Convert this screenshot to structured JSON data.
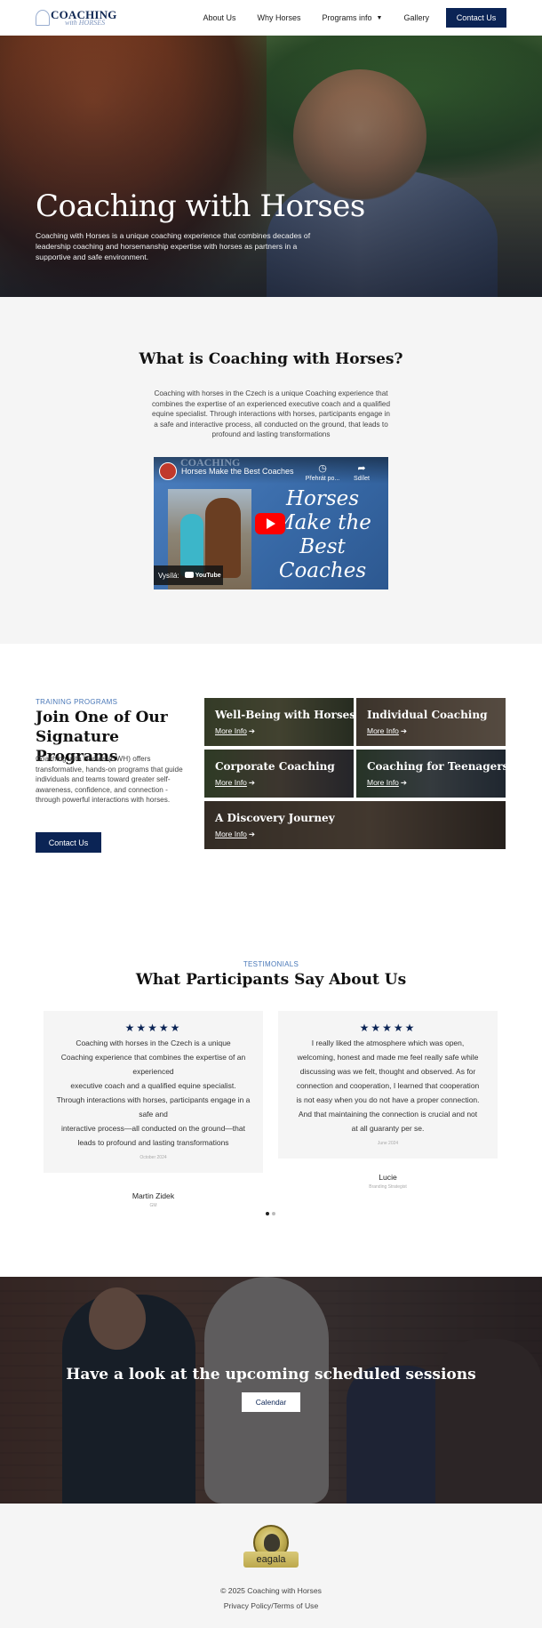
{
  "header": {
    "logo_main": "COACHING",
    "logo_sub": "with HORSES",
    "nav": [
      "About Us",
      "Why Horses",
      "Programs info",
      "Gallery"
    ],
    "contact_label": "Contact Us"
  },
  "hero": {
    "title": "Coaching with Horses",
    "description": "Coaching with Horses is a unique coaching experience that combines decades of leadership coaching and horsemanship expertise with horses as partners in a supportive and safe environment."
  },
  "what_is": {
    "title": "What is Coaching with Horses?",
    "description": "Coaching with horses in the Czech is a unique Coaching experience that combines the expertise of an experienced executive coach and a qualified equine specialist. Through interactions with horses, participants engage in a safe and interactive process, all conducted on the ground, that leads to profound and lasting transformations",
    "video": {
      "title": "Horses Make the Best Coaches",
      "watermark": "COACHING",
      "action_watch": "Přehrát po...",
      "action_share": "Sdílet",
      "overlay_text": "Horses Make the Best Coaches",
      "badge_label": "Vysílá:",
      "badge_brand": "YouTube"
    }
  },
  "programs": {
    "eyebrow": "TRAINING PROGRAMS",
    "title": "Join One of Our Signature Programs",
    "description": "Coaching with Horses (CWH) offers transformative, hands-on programs that guide individuals and teams toward greater self-awareness, confidence, and connection - through powerful interactions with horses.",
    "cta": "Contact Us",
    "link_label": "More Info",
    "cards": [
      {
        "title": "Well-Being with Horses"
      },
      {
        "title": "Individual Coaching"
      },
      {
        "title": "Corporate Coaching"
      },
      {
        "title": "Coaching for Teenagers"
      },
      {
        "title": "A Discovery Journey"
      }
    ]
  },
  "testimonials": {
    "eyebrow": "TESTIMONIALS",
    "title": "What Participants Say About Us",
    "stars": "★★★★★",
    "items": [
      {
        "lines": [
          "Coaching with horses in the Czech is a unique",
          "Coaching experience that combines the expertise of an experienced",
          "executive coach and a qualified equine specialist.",
          "Through interactions with horses, participants engage in a safe and",
          "interactive process—all conducted on the ground—that",
          "leads to profound and lasting transformations"
        ],
        "date": "October 2024",
        "name": "Martin Zidek",
        "role": "GM"
      },
      {
        "lines": [
          "I really liked the atmosphere which was open,",
          "welcoming, honest and made me feel really safe while",
          "discussing was we felt, thought and observed. As for",
          "connection and cooperation, I learned that cooperation",
          "is not easy when you do not have a proper connection.",
          "And that maintaining the connection is crucial and not",
          "at all guaranty per se."
        ],
        "date": "June 2024",
        "name": "Lucie",
        "role": "Branding Strategist"
      }
    ],
    "prev_icon": "chevron-left-icon",
    "next_icon": "chevron-right-icon"
  },
  "sessions": {
    "title": "Have a look at the upcoming scheduled sessions",
    "cta": "Calendar"
  },
  "footer": {
    "badge_text": "eagala",
    "badge_arc": "CERTIFIED PROFESSIONAL",
    "copyright": "© 2025 Coaching with Horses",
    "policy": "Privacy Policy/Terms of Use"
  },
  "colors": {
    "brand": "#0b2455",
    "accent": "#4a78b8",
    "section_bg": "#f5f5f5"
  }
}
